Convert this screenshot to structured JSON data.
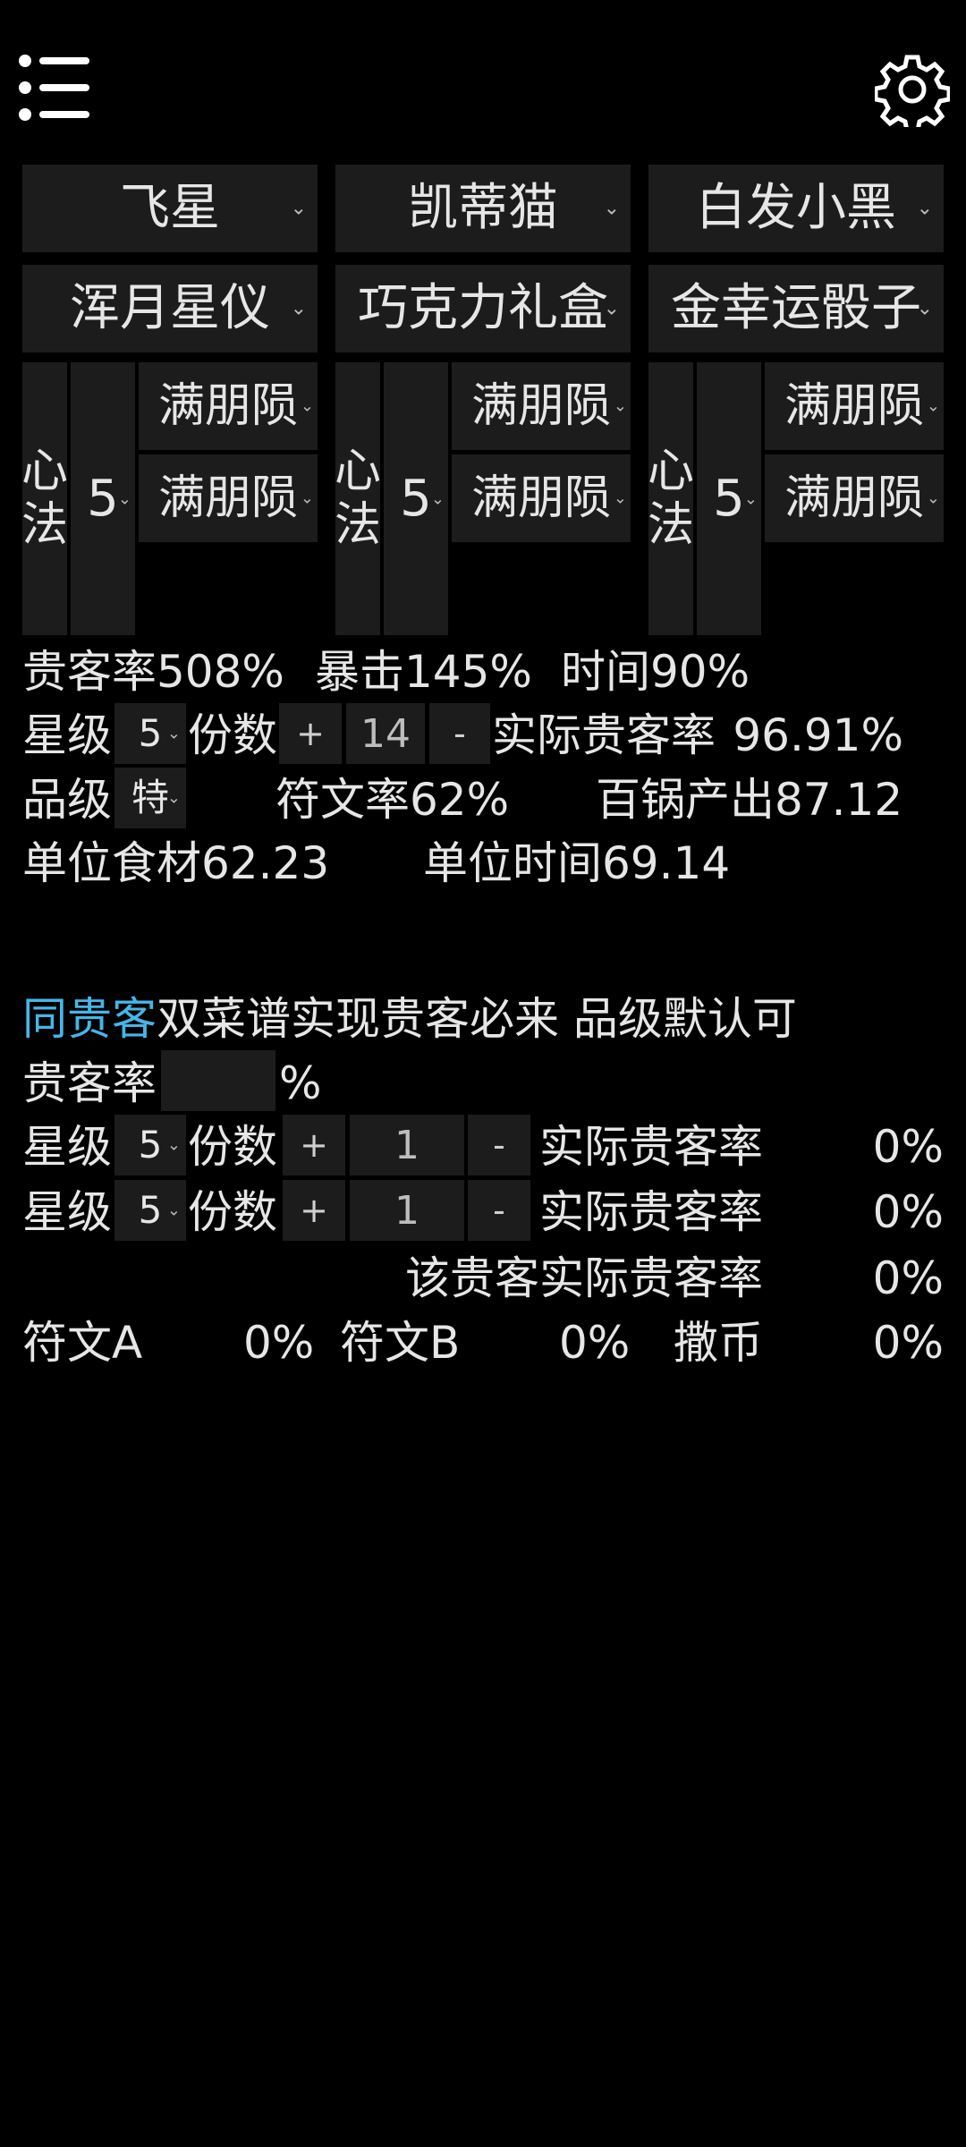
{
  "header": {
    "menu_icon": "list-icon",
    "settings_icon": "gear-icon"
  },
  "colors": {
    "accent": "#47b5e6",
    "panel": "#1c1c1c",
    "background": "#000000"
  },
  "chefs": [
    "飞星",
    "凯蒂猫",
    "白发小黑"
  ],
  "items": [
    "浑月星仪",
    "巧克力礼盒",
    "金幸运骰子"
  ],
  "xinfa": [
    {
      "label_1": "心",
      "label_2": "法",
      "level": "5",
      "skill_1": "满朋陨",
      "skill_2": "满朋陨"
    },
    {
      "label_1": "心",
      "label_2": "法",
      "level": "5",
      "skill_1": "满朋陨",
      "skill_2": "满朋陨"
    },
    {
      "label_1": "心",
      "label_2": "法",
      "level": "5",
      "skill_1": "满朋陨",
      "skill_2": "满朋陨"
    }
  ],
  "stats": {
    "guest_rate": "贵客率508%",
    "crit": "暴击145%",
    "time": "时间90%",
    "star_label": "星级",
    "star_value": "5",
    "portion_label": "份数",
    "plus": "+",
    "portion_value": "14",
    "minus": "-",
    "actual_guest_label": "实际贵客率",
    "actual_guest_value": "96.91%",
    "grade_label": "品级",
    "grade_value": "特",
    "rune_rate": "符文率62%",
    "pot_output": "百锅产出87.12",
    "unit_material": "单位食材62.23",
    "unit_time": "单位时间69.14"
  },
  "same_guest": {
    "title_accent": "同贵客",
    "title_rest": "双菜谱实现贵客必来 品级默认可",
    "rate_label": "贵客率",
    "rate_input": "",
    "percent": "%",
    "rows": [
      {
        "star_label": "星级",
        "star_value": "5",
        "portion_label": "份数",
        "plus": "+",
        "portion_value": "1",
        "minus": "-",
        "actual_label": "实际贵客率",
        "actual_value": "0%"
      },
      {
        "star_label": "星级",
        "star_value": "5",
        "portion_label": "份数",
        "plus": "+",
        "portion_value": "1",
        "minus": "-",
        "actual_label": "实际贵客率",
        "actual_value": "0%"
      }
    ],
    "guest_actual_label": "该贵客实际贵客率",
    "guest_actual_value": "0%",
    "rune_a_label": "符文A",
    "rune_a_value": "0%",
    "rune_b_label": "符文B",
    "rune_b_value": "0%",
    "coin_label": "撒币",
    "coin_value": "0%"
  }
}
